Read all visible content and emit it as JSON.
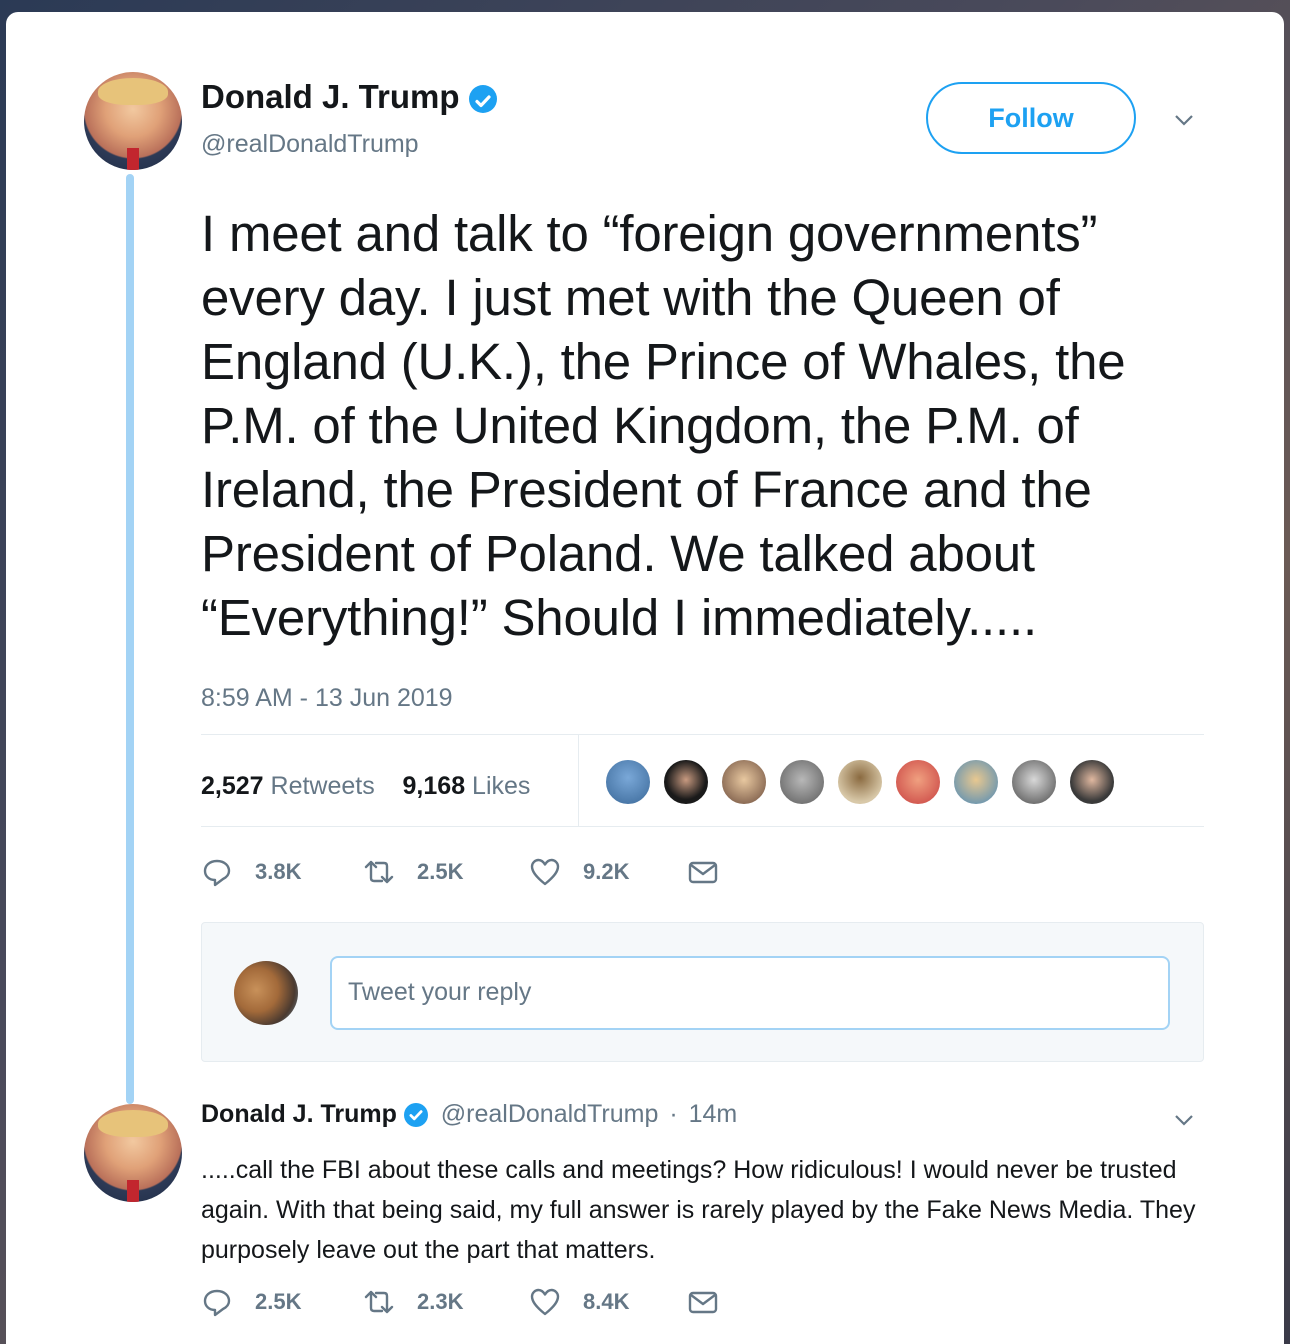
{
  "tweet": {
    "author_name": "Donald J. Trump",
    "author_handle": "@realDonaldTrump",
    "follow_label": "Follow",
    "text": "I meet and talk to “foreign governments” every day. I just met with the Queen of England (U.K.), the Prince of Whales, the P.M. of the United Kingdom, the P.M. of Ireland, the President of France and the President of Poland. We talked about “Everything!” Should I immediately.....",
    "timestamp": "8:59 AM - 13 Jun 2019",
    "retweets_count": "2,527",
    "retweets_label": "Retweets",
    "likes_count": "9,168",
    "likes_label": "Likes",
    "actions": {
      "replies": "3.8K",
      "retweets": "2.5K",
      "likes": "9.2K"
    }
  },
  "reply_box": {
    "placeholder": "Tweet your reply"
  },
  "reply_tweet": {
    "author_name": "Donald J. Trump",
    "author_handle": "@realDonaldTrump",
    "separator": "·",
    "age": "14m",
    "text": ".....call the FBI about these calls and meetings? How ridiculous! I would never be trusted again. With that being said, my full answer is rarely played by the Fake News Media. They purposely leave out the part that matters.",
    "actions": {
      "replies": "2.5K",
      "retweets": "2.3K",
      "likes": "8.4K"
    }
  },
  "colors": {
    "accent": "#1da1f2",
    "text_primary": "#14171a",
    "text_secondary": "#657786",
    "thread_line": "#a3d3f5",
    "divider": "#e6ecf0"
  },
  "icons": {
    "verified": "verified-badge-icon",
    "chevron": "chevron-down-icon",
    "reply": "reply-icon",
    "retweet": "retweet-icon",
    "like": "heart-icon",
    "dm": "envelope-icon"
  }
}
